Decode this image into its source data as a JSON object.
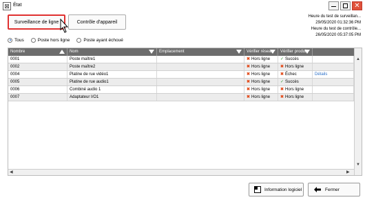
{
  "window": {
    "title": "État",
    "close_glyph": "✕"
  },
  "tabs": {
    "line_monitor": "Surveillance de ligne",
    "device_check": "Contrôle d'appareil"
  },
  "info": {
    "line1": "Heure du test de surveillan...",
    "line2": "29/05/2020 01:32:36 PM",
    "line3": "Heure du test de contrôle...",
    "line4": "26/05/2020 05:37:05 PM"
  },
  "filters": {
    "all": "Tous",
    "offline": "Poste hors ligne",
    "failed": "Poste ayant échoué"
  },
  "table": {
    "headers": {
      "number": "Nombre",
      "name": "Nom",
      "location": "Emplacement",
      "network": "Vérifier réseau",
      "product": "Vérifier produit"
    },
    "rows": [
      {
        "number": "0001",
        "name": "Poste maître1",
        "location": "",
        "network": "Hors ligne",
        "network_status": "x",
        "product": "Succès",
        "product_status": "ok",
        "details": ""
      },
      {
        "number": "0002",
        "name": "Poste maître2",
        "location": "",
        "network": "Hors ligne",
        "network_status": "x",
        "product": "Hors ligne",
        "product_status": "x",
        "details": ""
      },
      {
        "number": "0004",
        "name": "Platine de rue vidéo1",
        "location": "",
        "network": "Hors ligne",
        "network_status": "x",
        "product": "Échec",
        "product_status": "x",
        "details": "Détails"
      },
      {
        "number": "0005",
        "name": "Platine de rue audio1",
        "location": "",
        "network": "Hors ligne",
        "network_status": "x",
        "product": "Succès",
        "product_status": "ok",
        "details": ""
      },
      {
        "number": "0006",
        "name": "Combiné audio 1",
        "location": "",
        "network": "Hors ligne",
        "network_status": "x",
        "product": "Hors ligne",
        "product_status": "x",
        "details": ""
      },
      {
        "number": "0007",
        "name": "Adaptateur I/O1",
        "location": "",
        "network": "Hors ligne",
        "network_status": "x",
        "product": "Hors ligne",
        "product_status": "x",
        "details": ""
      }
    ]
  },
  "footer": {
    "info_label": "Information logiciel",
    "close_label": "Fermer"
  },
  "glyphs": {
    "x": "✖",
    "ok": "✓",
    "up": "▲",
    "down": "▼",
    "left": "◀",
    "right": "▶"
  },
  "colors": {
    "highlight": "#e0302f",
    "header": "#6d6d6d",
    "error": "#e24a1a",
    "ok": "#3a9a3a",
    "link": "#2a6fc9"
  }
}
